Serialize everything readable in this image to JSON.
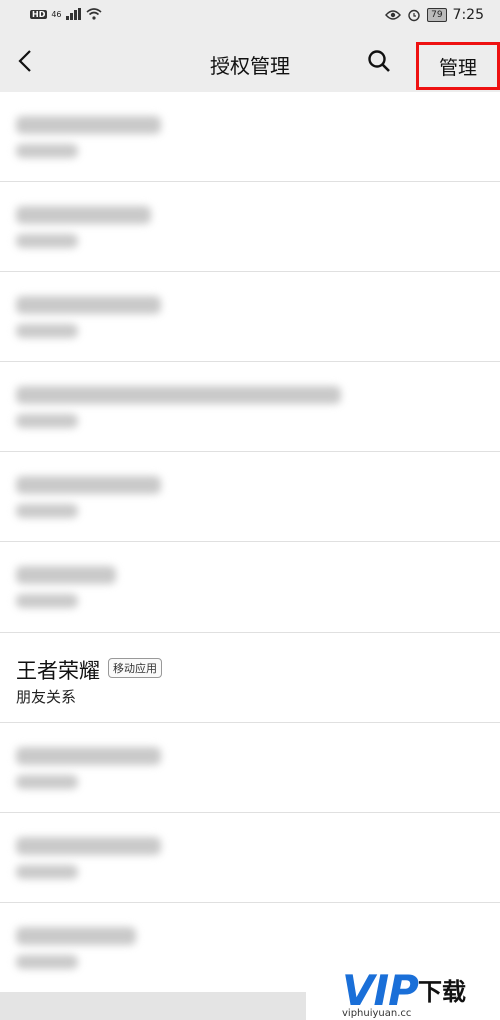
{
  "status_bar": {
    "network": "HD",
    "signal": "46",
    "battery": "79",
    "time": "7:25"
  },
  "nav": {
    "title": "授权管理",
    "manage_label": "管理"
  },
  "items": [
    {
      "title": "王者荣耀",
      "tag": "移动应用",
      "subtitle": "朋友关系"
    }
  ],
  "watermark": {
    "logo": "VIP",
    "text": "下载",
    "url": "viphuiyuan.cc"
  },
  "colors": {
    "highlight_border": "#ee1111",
    "watermark_blue": "#1a6fd8",
    "background": "#ededed"
  }
}
